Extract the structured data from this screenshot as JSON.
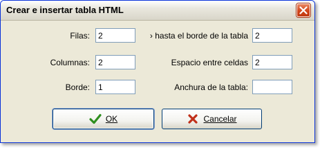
{
  "dialog": {
    "title": "Crear e insertar tabla HTML",
    "close_icon": "close-icon",
    "accent_color": "#d1451b"
  },
  "fields": {
    "rows": {
      "label": "Filas:",
      "value": "2"
    },
    "columns": {
      "label": "Columnas:",
      "value": "2"
    },
    "border": {
      "label": "Borde:",
      "value": "1"
    },
    "cell_padding": {
      "label": "› hasta el borde de la tabla",
      "value": "2"
    },
    "cell_spacing": {
      "label": "Espacio entre celdas",
      "value": "2"
    },
    "table_width": {
      "label": "Anchura de la tabla:",
      "value": ""
    }
  },
  "buttons": {
    "ok": {
      "label": "OK",
      "icon": "checkmark-icon",
      "icon_color": "#2f8f1f"
    },
    "cancel": {
      "label": "Cancelar",
      "icon": "x-icon",
      "icon_color": "#c0301a"
    }
  }
}
